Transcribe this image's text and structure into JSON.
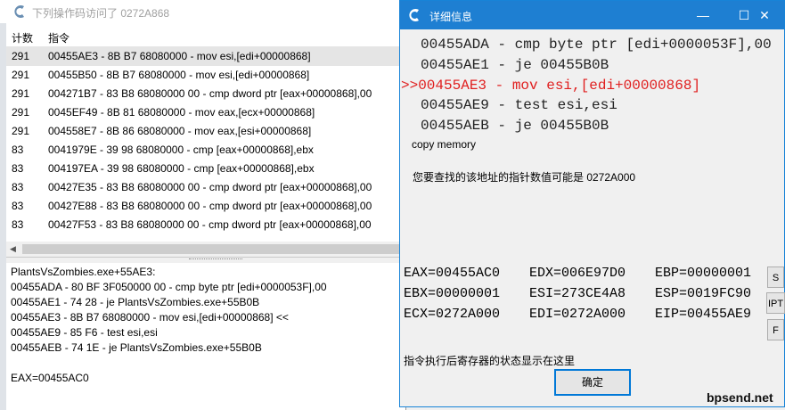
{
  "back_window": {
    "title": "下列操作码访问了 0272A868",
    "columns": {
      "count": "计数",
      "instruction": "指令"
    },
    "rows": [
      {
        "count": "291",
        "instruction": "00455AE3 - 8B B7 68080000  - mov esi,[edi+00000868]"
      },
      {
        "count": "291",
        "instruction": "00455B50 - 8B B7 68080000  - mov esi,[edi+00000868]"
      },
      {
        "count": "291",
        "instruction": "004271B7 - 83 B8 68080000 00 - cmp dword ptr [eax+00000868],00"
      },
      {
        "count": "291",
        "instruction": "0045EF49 - 8B 81 68080000  - mov eax,[ecx+00000868]"
      },
      {
        "count": "291",
        "instruction": "004558E7 - 8B 86 68080000  - mov eax,[esi+00000868]"
      },
      {
        "count": "83",
        "instruction": "0041979E - 39 98 68080000  - cmp [eax+00000868],ebx"
      },
      {
        "count": "83",
        "instruction": "004197EA - 39 98 68080000  - cmp [eax+00000868],ebx"
      },
      {
        "count": "83",
        "instruction": "00427E35 - 83 B8 68080000 00 - cmp dword ptr [eax+00000868],00"
      },
      {
        "count": "83",
        "instruction": "00427E88 - 83 B8 68080000 00 - cmp dword ptr [eax+00000868],00"
      },
      {
        "count": "83",
        "instruction": "00427F53 - 83 B8 68080000 00 - cmp dword ptr [eax+00000868],00"
      }
    ],
    "detail_lines": [
      "PlantsVsZombies.exe+55AE3:",
      "00455ADA - 80 BF 3F050000 00 - cmp byte ptr [edi+0000053F],00",
      "00455AE1 - 74 28 - je PlantsVsZombies.exe+55B0B",
      "00455AE3 - 8B B7 68080000  - mov esi,[edi+00000868] <<",
      "00455AE9 - 85 F6  - test esi,esi",
      "00455AEB - 74 1E - je PlantsVsZombies.exe+55B0B",
      "",
      "EAX=00455AC0"
    ]
  },
  "dialog": {
    "title": "详细信息",
    "code_lines": [
      "00455ADA - cmp byte ptr [edi+0000053F],00",
      "00455AE1 - je 00455B0B",
      ">>00455AE3 - mov esi,[edi+00000868]",
      "00455AE9 - test esi,esi",
      "00455AEB - je 00455B0B"
    ],
    "copy_memory": "copy memory",
    "pointer_hint": "您要查找的该地址的指针数值可能是 0272A000",
    "registers": [
      [
        "EAX=00455AC0",
        "EDX=006E97D0",
        "EBP=00000001"
      ],
      [
        "EBX=00000001",
        "ESI=273CE4A8",
        "ESP=0019FC90"
      ],
      [
        "ECX=0272A000",
        "EDI=0272A000",
        "EIP=00455AE9"
      ]
    ],
    "side_buttons": [
      "S",
      "IPT",
      "F"
    ],
    "status_note": "指令执行后寄存器的状态显示在这里",
    "ok_label": "确定",
    "window_buttons": {
      "minimize": "—",
      "maximize": "☐",
      "close": "✕"
    }
  },
  "watermark": "bpsend.net",
  "colors": {
    "titlebar": "#1e7fd2",
    "current_line": "#e02020"
  }
}
